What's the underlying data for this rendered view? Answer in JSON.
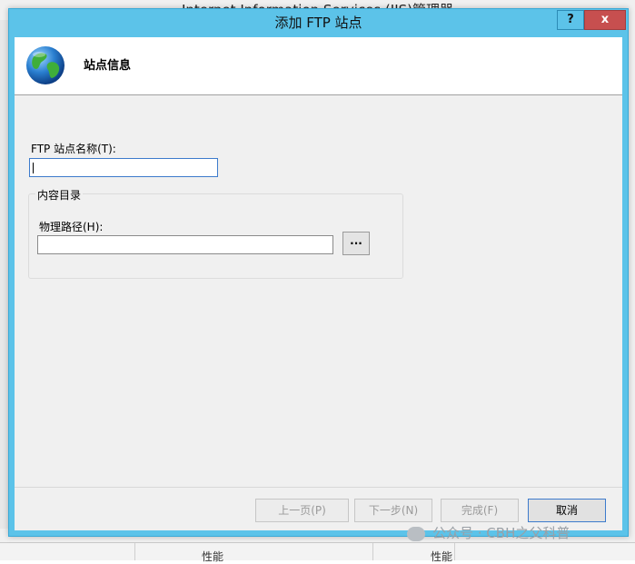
{
  "background_window": {
    "title": "Internet Information Services (IIS)管理器",
    "bottom_col_1": "性能",
    "bottom_col_2": "性能"
  },
  "dialog": {
    "title": "添加 FTP 站点",
    "help_label": "?",
    "close_label": "x",
    "header_title": "站点信息",
    "site_name_label": "FTP 站点名称(T):",
    "site_name_value": "",
    "content_group_label": "内容目录",
    "physical_path_label": "物理路径(H):",
    "physical_path_value": "",
    "browse_label": "...",
    "buttons": {
      "prev": "上一页(P)",
      "next": "下一步(N)",
      "finish": "完成(F)",
      "cancel": "取消"
    }
  },
  "watermark": {
    "text": "公众号 · CBH之父科普"
  },
  "colors": {
    "title_bar": "#5cc3e9",
    "close_button": "#c74f4f",
    "dialog_background": "#f0f0f0",
    "header_background": "#ffffff",
    "focus_border": "#3d7bcc"
  },
  "icons": {
    "header": "globe-icon",
    "watermark": "wechat-icon"
  }
}
